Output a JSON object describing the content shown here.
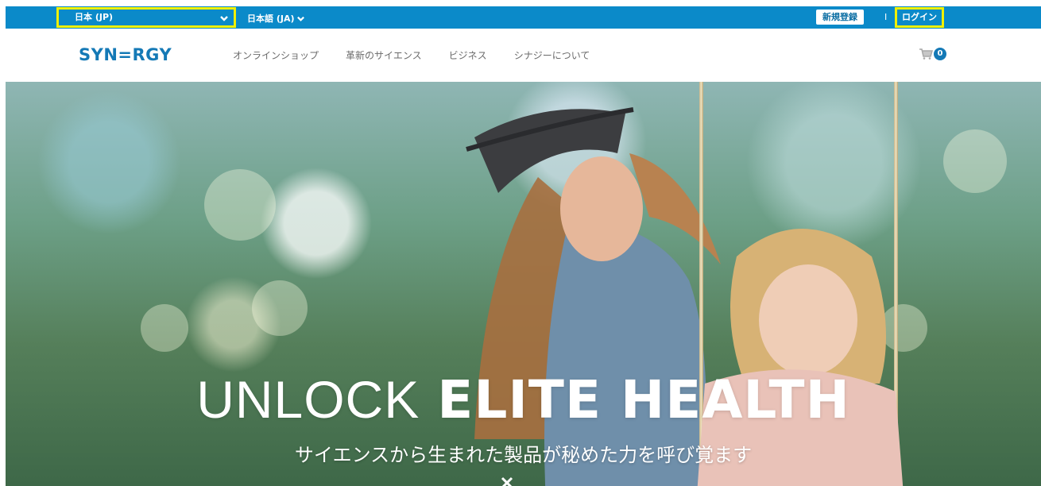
{
  "topbar": {
    "country_label": "日本 (JP)",
    "language_label": "日本語 (JA)",
    "register_label": "新規登録",
    "separator": "I",
    "login_label": "ログイン"
  },
  "nav": {
    "logo_text": "SYN=RGY",
    "links": [
      {
        "label": "オンラインショップ"
      },
      {
        "label": "革新のサイエンス"
      },
      {
        "label": "ビジネス"
      },
      {
        "label": "シナジーについて"
      }
    ],
    "cart_count": "0"
  },
  "hero": {
    "headline_light": "UNLOCK",
    "headline_bold": "ELITE HEALTH",
    "subheading": "サイエンスから生まれた製品が秘めた力を呼び覚ます"
  },
  "colors": {
    "topbar_bg": "#0b8ac9",
    "highlight_border": "#f0f000",
    "brand_blue": "#1479b6"
  },
  "icons": {
    "country_chevron": "chevron-down-icon",
    "language_chevron": "chevron-down-icon",
    "cart": "cart-icon",
    "close": "close-icon"
  }
}
